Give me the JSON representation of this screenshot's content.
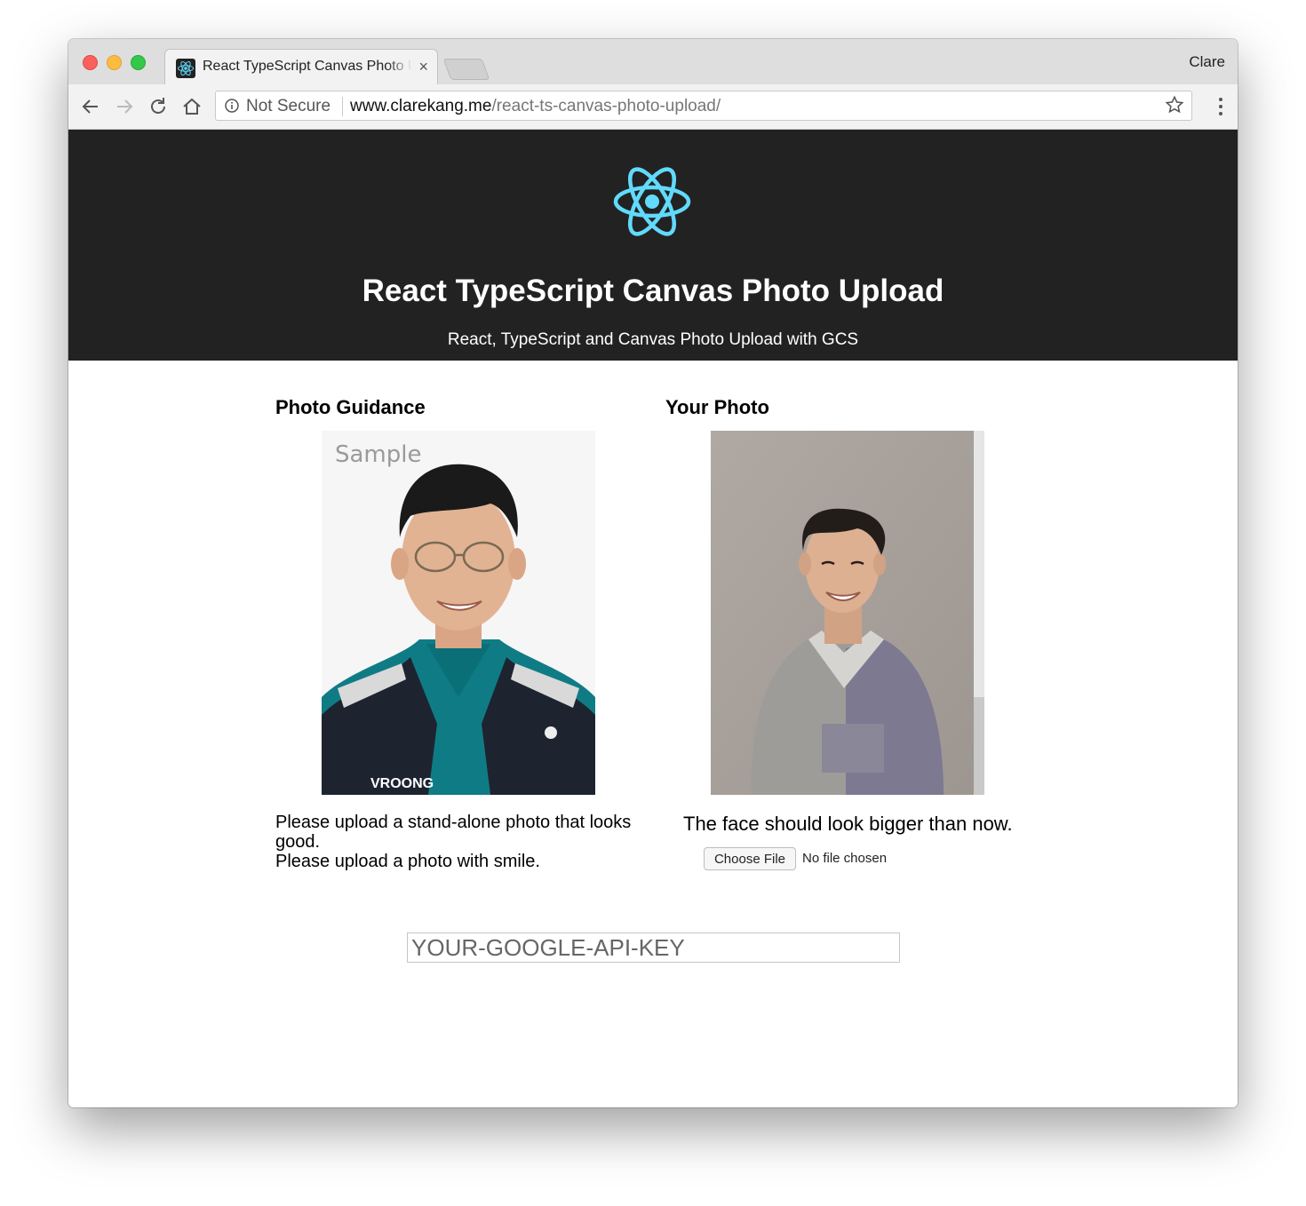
{
  "browser": {
    "tab_title": "React TypeScript Canvas Photo Upload",
    "tab_close": "×",
    "profile_name": "Clare",
    "security_label": "Not Secure",
    "url_host": "www.clarekang.me",
    "url_path": "/react-ts-canvas-photo-upload/",
    "nav_icons": [
      "back-arrow-icon",
      "forward-arrow-icon",
      "reload-icon",
      "home-icon"
    ],
    "star_icon": "bookmark-star-icon",
    "menu_icon": "kebab-menu-icon"
  },
  "header": {
    "logo": "react-atom-logo",
    "title": "React TypeScript Canvas Photo Upload",
    "subtitle": "React, TypeScript and Canvas Photo Upload with GCS",
    "background": "#222222",
    "logo_color": "#61dafb"
  },
  "guidance": {
    "heading": "Photo Guidance",
    "sample_label": "Sample",
    "vest_text": "VROONG",
    "line1": "Please upload a stand-alone photo that looks good.",
    "line2": "Please upload a photo with smile."
  },
  "your_photo": {
    "heading": "Your Photo",
    "feedback": "The face should look bigger than now.",
    "choose_file_label": "Choose File",
    "file_status": "No file chosen"
  },
  "api_key": {
    "placeholder": "YOUR-GOOGLE-API-KEY"
  }
}
